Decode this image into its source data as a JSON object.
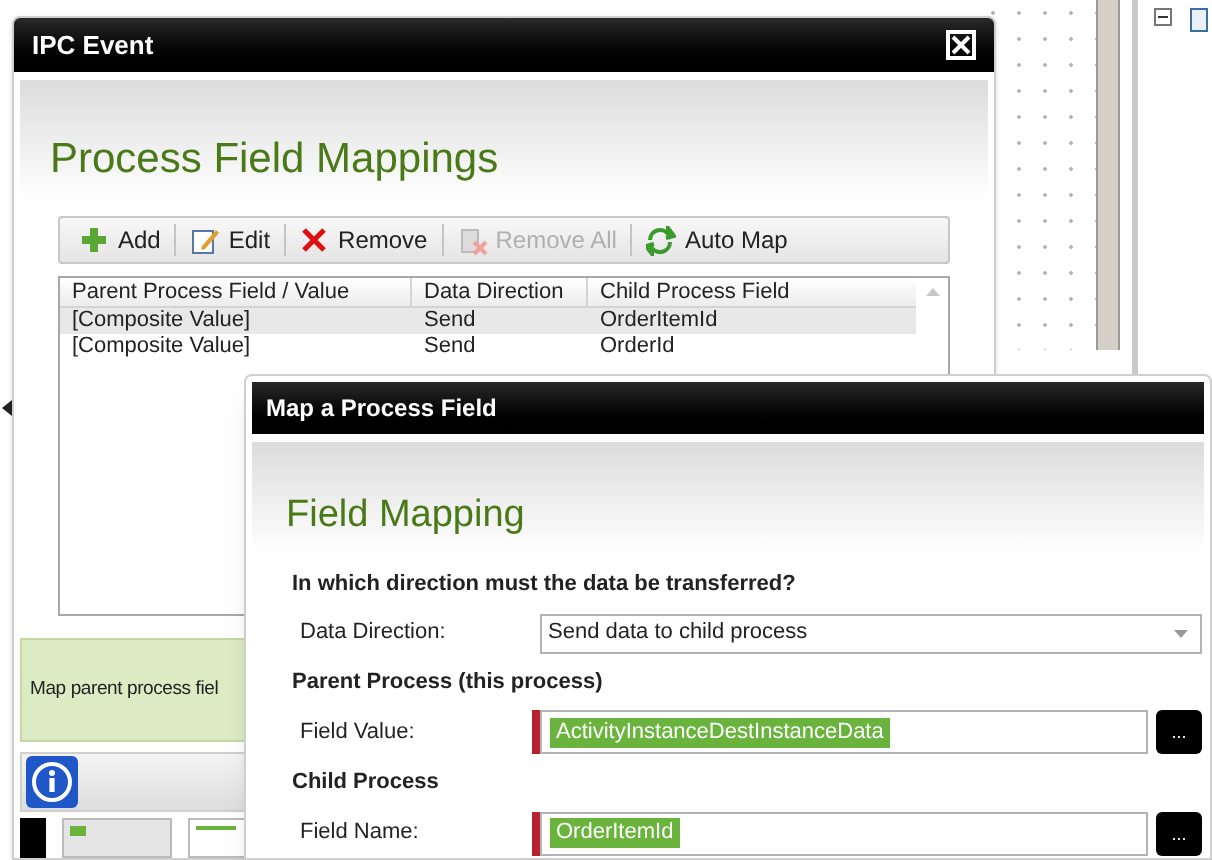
{
  "ipc_window": {
    "title": "IPC Event",
    "heading": "Process Field Mappings",
    "toolbar": [
      {
        "label": "Add",
        "kind": "add",
        "disabled": false
      },
      {
        "label": "Edit",
        "kind": "edit",
        "disabled": false
      },
      {
        "label": "Remove",
        "kind": "remove",
        "disabled": false
      },
      {
        "label": "Remove All",
        "kind": "clear",
        "disabled": true
      },
      {
        "label": "Auto Map",
        "kind": "sync",
        "disabled": false
      }
    ],
    "table": {
      "columns": [
        "Parent Process Field / Value",
        "Data Direction",
        "Child Process Field"
      ],
      "rows": [
        {
          "cells": [
            "[Composite Value]",
            "Send",
            "OrderItemId"
          ],
          "selected": true
        },
        {
          "cells": [
            "[Composite Value]",
            "Send",
            "OrderId"
          ],
          "selected": false
        }
      ]
    },
    "info_text": "Map parent process fiel"
  },
  "map_dialog": {
    "title": "Map a Process Field",
    "heading": "Field Mapping",
    "question": "In which direction must the data be transferred?",
    "direction": {
      "label": "Data Direction:",
      "value": "Send data to child process"
    },
    "sections": [
      {
        "title": "Parent Process (this process)",
        "label": "Field Value:",
        "token": "ActivityInstanceDestInstanceData",
        "button": "..."
      },
      {
        "title": "Child Process",
        "label": "Field Name:",
        "token": "OrderItemId",
        "button": "..."
      }
    ]
  }
}
